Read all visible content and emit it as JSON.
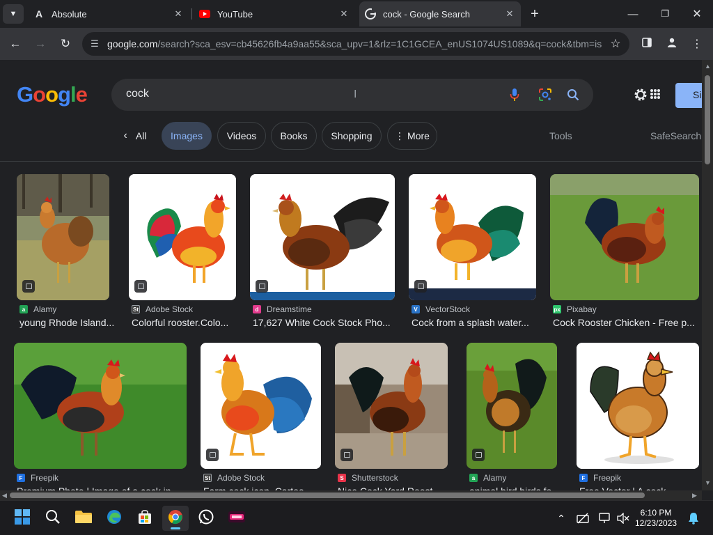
{
  "browser": {
    "tabs": [
      {
        "title": "Absolute",
        "favicon": "absolute-logo-icon",
        "active": false
      },
      {
        "title": "YouTube",
        "favicon": "youtube-icon",
        "active": false
      },
      {
        "title": "cock - Google Search",
        "favicon": "google-g-icon",
        "active": true
      }
    ],
    "url_host": "google.com",
    "url_rest": "/search?sca_esv=cb45626fb4a9aa55&sca_upv=1&rlz=1C1GCEA_enUS1074US1089&q=cock&tbm=is..."
  },
  "search": {
    "logo": "Google",
    "query": "cock",
    "signin_label": "Si",
    "chips": [
      {
        "label": "All",
        "icon": "chevron-left-icon",
        "active": false
      },
      {
        "label": "Images",
        "active": true
      },
      {
        "label": "Videos",
        "active": false
      },
      {
        "label": "Books",
        "active": false
      },
      {
        "label": "Shopping",
        "active": false
      },
      {
        "label": "More",
        "icon": "vertical-dots-icon",
        "active": false
      }
    ],
    "tools_label": "Tools",
    "safesearch_label": "SafeSearch"
  },
  "results": [
    {
      "source": "Alamy",
      "source_color": "#22a355",
      "caption": "young Rhode Island..."
    },
    {
      "source": "Adobe Stock",
      "source_color": "#3a3a3a",
      "caption": "Colorful rooster.Colo..."
    },
    {
      "source": "Dreamstime",
      "source_color": "#e23b8d",
      "caption": "17,627 White Cock Stock Pho..."
    },
    {
      "source": "VectorStock",
      "source_color": "#2b74c7",
      "caption": "Cock from a splash water..."
    },
    {
      "source": "Pixabay",
      "source_color": "#2ec66d",
      "caption": "Cock Rooster Chicken - Free p..."
    },
    {
      "source": "Freepik",
      "source_color": "#1f6fe0",
      "caption": "Premium Photo | Image of a cock in..."
    },
    {
      "source": "Adobe Stock",
      "source_color": "#3a3a3a",
      "caption": "Farm cock icon. Cartoo..."
    },
    {
      "source": "Shutterstock",
      "source_color": "#e8334a",
      "caption": "Nice Cock Yard Roost..."
    },
    {
      "source": "Alamy",
      "source_color": "#22a355",
      "caption": "animal bird birds fo..."
    },
    {
      "source": "Freepik",
      "source_color": "#1f6fe0",
      "caption": "Free Vector | A cock..."
    }
  ],
  "taskbar": {
    "time": "6:10 PM",
    "date": "12/23/2023"
  },
  "colors": {
    "accent": "#8ab4f8",
    "page_bg": "#202124",
    "chip_active_bg": "#394457"
  }
}
